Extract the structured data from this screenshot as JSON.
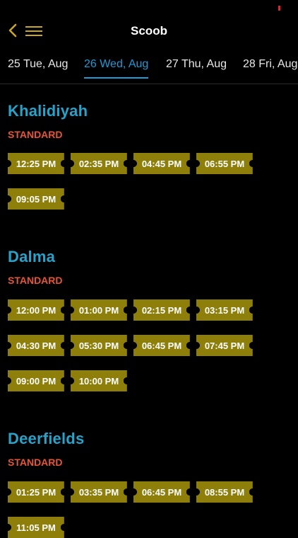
{
  "header": {
    "title": "Scoob",
    "back_icon": "chevron-left-icon",
    "menu_icon": "hamburger-menu-icon",
    "accent_color": "#c9a52a"
  },
  "tabs": [
    {
      "label": "25 Tue, Aug",
      "active": false
    },
    {
      "label": "26 Wed, Aug",
      "active": true
    },
    {
      "label": "27 Thu, Aug",
      "active": false
    },
    {
      "label": "28 Fri, Aug",
      "active": false
    }
  ],
  "colors": {
    "active_tab": "#1e9ad6",
    "cinema_name": "#27a2c9",
    "format_label": "#e85434",
    "ticket": "#8e7f0a"
  },
  "cinemas": [
    {
      "name": "Khalidiyah",
      "format": "STANDARD",
      "times": [
        "12:25 PM",
        "02:35 PM",
        "04:45 PM",
        "06:55 PM",
        "09:05 PM"
      ]
    },
    {
      "name": "Dalma",
      "format": "STANDARD",
      "times": [
        "12:00 PM",
        "01:00 PM",
        "02:15 PM",
        "03:15 PM",
        "04:30 PM",
        "05:30 PM",
        "06:45 PM",
        "07:45 PM",
        "09:00 PM",
        "10:00 PM"
      ]
    },
    {
      "name": "Deerfields",
      "format": "STANDARD",
      "times": [
        "01:25 PM",
        "03:35 PM",
        "06:45 PM",
        "08:55 PM",
        "11:05 PM"
      ]
    }
  ]
}
